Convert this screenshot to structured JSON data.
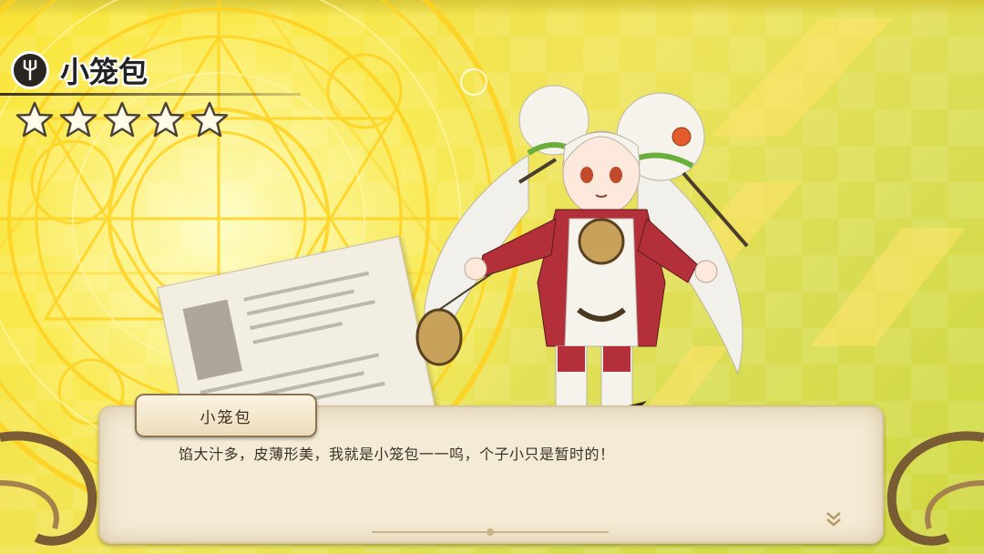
{
  "character": {
    "name": "小笼包",
    "star_rating": 0,
    "star_max": 5
  },
  "dialog": {
    "speaker": "小笼包",
    "line": "馅大汁多，皮薄形美，我就是小笼包一一呜，个子小只是暂时的！"
  },
  "icons": {
    "role_badge": "fork-icon",
    "advance": "chevron-double-down-icon"
  },
  "colors": {
    "background": "#efe45a",
    "magic_circle": "#ffcf2a",
    "dialog_parchment": "#f4ebd6",
    "frame_brown": "#8d7453",
    "dress_red": "#b3303a"
  }
}
